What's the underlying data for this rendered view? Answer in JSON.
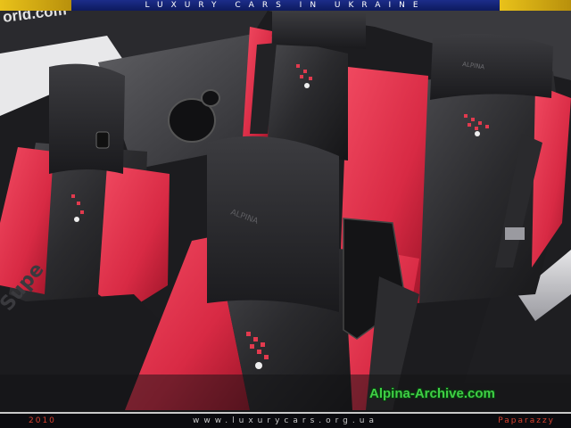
{
  "banner": {
    "title": "LUXURY CARS IN UKRAINE"
  },
  "footer": {
    "year": "2010",
    "url": "www.luxurycars.org.ua",
    "credit": "Paparazzy"
  },
  "watermark": {
    "text": "Alpina-Archive.com"
  },
  "seat_branding": {
    "headrest_logo": "ALPINA"
  },
  "side_text": "orld.com",
  "colors": {
    "leather_red": "#e0314a",
    "leather_black": "#2b2b2e",
    "banner_blue": "#15257a",
    "banner_gold": "#e0b818",
    "watermark_green": "#3fcf45"
  }
}
